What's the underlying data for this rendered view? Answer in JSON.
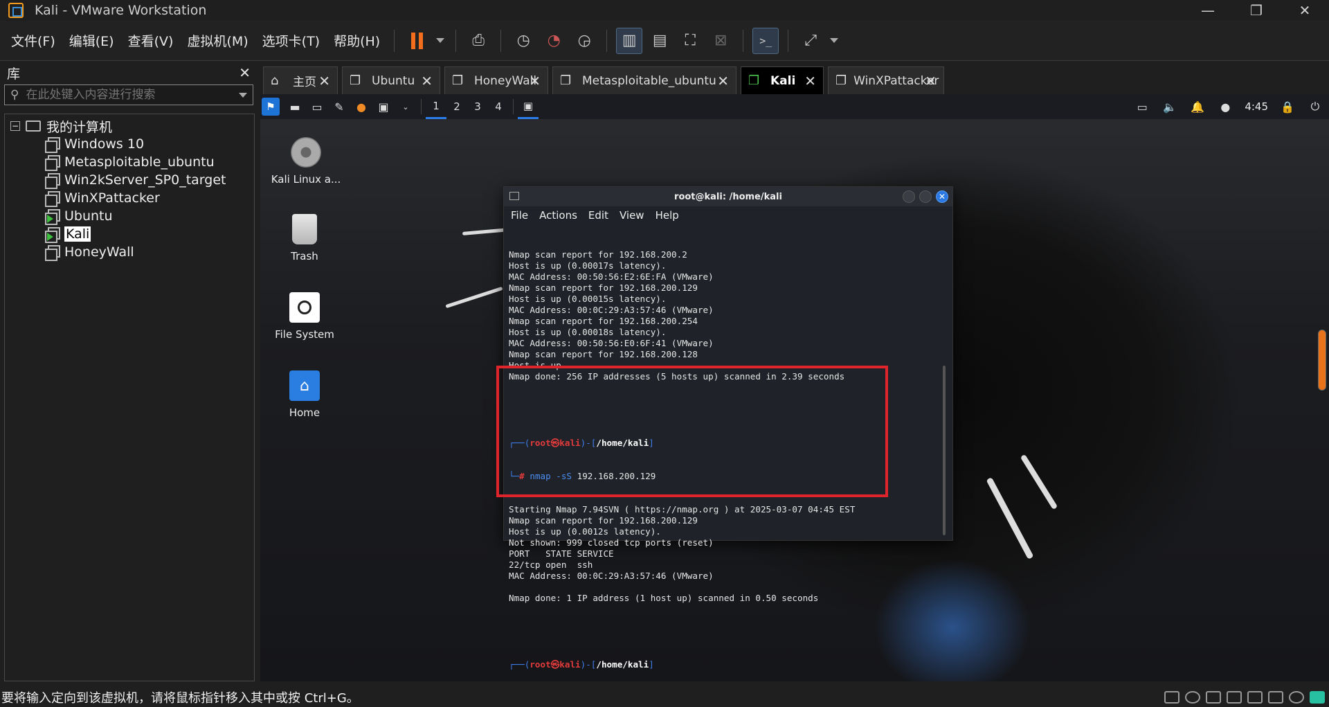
{
  "window": {
    "title": "Kali - VMware Workstation"
  },
  "menubar": {
    "items": [
      "文件(F)",
      "编辑(E)",
      "查看(V)",
      "虚拟机(M)",
      "选项卡(T)",
      "帮助(H)"
    ]
  },
  "library": {
    "title": "库",
    "search_placeholder": "在此处键入内容进行搜索",
    "root": "我的计算机",
    "vms": [
      {
        "name": "Windows 10",
        "running": false,
        "selected": false
      },
      {
        "name": "Metasploitable_ubuntu",
        "running": false,
        "selected": false
      },
      {
        "name": "Win2kServer_SP0_target",
        "running": false,
        "selected": false
      },
      {
        "name": "WinXPattacker",
        "running": false,
        "selected": false
      },
      {
        "name": "Ubuntu",
        "running": true,
        "selected": false
      },
      {
        "name": "Kali",
        "running": true,
        "selected": true
      },
      {
        "name": "HoneyWall",
        "running": false,
        "selected": false
      }
    ]
  },
  "tabs": [
    {
      "label": "主页",
      "active": false
    },
    {
      "label": "Ubuntu",
      "active": false
    },
    {
      "label": "HoneyWall",
      "active": false
    },
    {
      "label": "Metasploitable_ubuntu",
      "active": false
    },
    {
      "label": "Kali",
      "active": true
    },
    {
      "label": "WinXPattacker",
      "active": false
    }
  ],
  "kali_panel": {
    "workspaces": [
      "1",
      "2",
      "3",
      "4"
    ],
    "active_workspace": "1",
    "clock": "4:45"
  },
  "desktop_icons": [
    {
      "label": "Kali Linux a...",
      "icon": "cdrom-icon"
    },
    {
      "label": "Trash",
      "icon": "trash-icon"
    },
    {
      "label": "File System",
      "icon": "filesystem-icon"
    },
    {
      "label": "Home",
      "icon": "home-folder-icon"
    }
  ],
  "terminal": {
    "title": "root@kali: /home/kali",
    "menu": [
      "File",
      "Actions",
      "Edit",
      "View",
      "Help"
    ],
    "output_top": [
      "Nmap scan report for 192.168.200.2",
      "Host is up (0.00017s latency).",
      "MAC Address: 00:50:56:E2:6E:FA (VMware)",
      "Nmap scan report for 192.168.200.129",
      "Host is up (0.00015s latency).",
      "MAC Address: 00:0C:29:A3:57:46 (VMware)",
      "Nmap scan report for 192.168.200.254",
      "Host is up (0.00018s latency).",
      "MAC Address: 00:50:56:E0:6F:41 (VMware)",
      "Nmap scan report for 192.168.200.128",
      "Host is up.",
      "Nmap done: 256 IP addresses (5 hosts up) scanned in 2.39 seconds"
    ],
    "prompt": {
      "user": "root",
      "at": "㉿",
      "host": "kali",
      "path": "/home/kali"
    },
    "command": "nmap -sS 192.168.200.129",
    "output_scan": [
      "Starting Nmap 7.94SVN ( https://nmap.org ) at 2025-03-07 04:45 EST",
      "Nmap scan report for 192.168.200.129",
      "Host is up (0.0012s latency).",
      "Not shown: 999 closed tcp ports (reset)",
      "PORT   STATE SERVICE",
      "22/tcp open  ssh",
      "MAC Address: 00:0C:29:A3:57:46 (VMware)",
      "",
      "Nmap done: 1 IP address (1 host up) scanned in 0.50 seconds"
    ]
  },
  "statusbar": {
    "message": "要将输入定向到该虚拟机，请将鼠标指针移入其中或按 Ctrl+G。"
  },
  "colors": {
    "highlight_box": "#e0242b",
    "kali_blue": "#2b7de9",
    "pause_orange": "#f26d1c"
  }
}
